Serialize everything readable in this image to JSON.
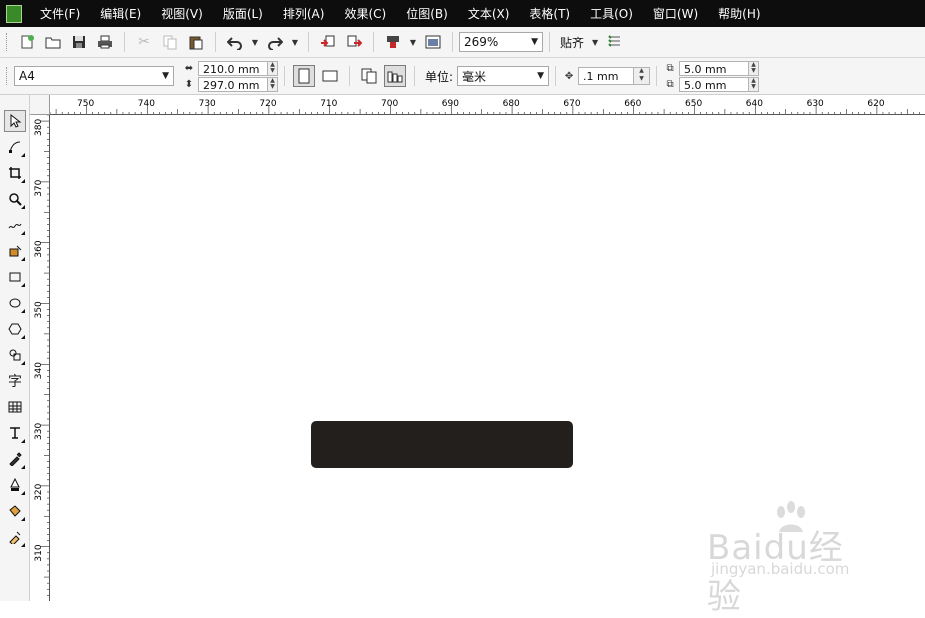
{
  "menu": {
    "items": [
      "文件(F)",
      "编辑(E)",
      "视图(V)",
      "版面(L)",
      "排列(A)",
      "效果(C)",
      "位图(B)",
      "文本(X)",
      "表格(T)",
      "工具(O)",
      "窗口(W)",
      "帮助(H)"
    ]
  },
  "toolbar": {
    "zoom": "269%",
    "snap_label": "贴齐"
  },
  "property_bar": {
    "page_size": "A4",
    "width": "210.0 mm",
    "height": "297.0 mm",
    "unit_label": "单位:",
    "unit_value": "毫米",
    "nudge": ".1 mm",
    "dup_x": "5.0 mm",
    "dup_y": "5.0 mm"
  },
  "rulers": {
    "horizontal": [
      "750",
      "740",
      "730",
      "720",
      "710",
      "700",
      "690",
      "680",
      "670",
      "660",
      "650",
      "640",
      "630",
      "620"
    ],
    "vertical": [
      "380",
      "370",
      "360",
      "350",
      "340",
      "330",
      "320",
      "310"
    ]
  },
  "watermark": {
    "brand": "Baidu经验",
    "url": "jingyan.baidu.com"
  },
  "colors": {
    "menubar": "#0d0d0d",
    "shape_fill": "#231f1d"
  },
  "icons": [
    "new-icon",
    "open-icon",
    "save-icon",
    "print-icon",
    "cut-icon",
    "copy-icon",
    "paste-icon",
    "undo-icon",
    "redo-icon",
    "import-icon",
    "export-icon",
    "app-launcher-icon",
    "welcome-screen-icon",
    "snap-options-icon"
  ]
}
